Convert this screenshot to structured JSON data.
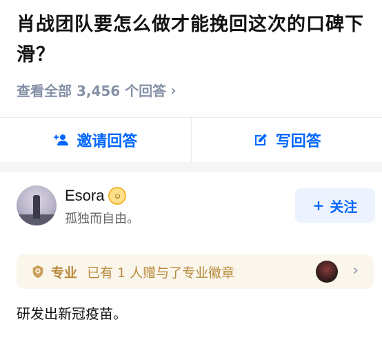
{
  "question": {
    "title": "肖战团队要怎么做才能挽回这次的口碑下滑？",
    "view_all": "查看全部 3,456 个回答",
    "chevron": "›"
  },
  "actions": {
    "invite_label": "邀请回答",
    "write_label": "写回答",
    "invite_icon": "add-person-icon",
    "write_icon": "edit-icon"
  },
  "answer": {
    "author_name": "Esora",
    "author_bio": "孤独而自由。",
    "follow_label": "关注",
    "follow_plus": "+",
    "pro_label": "专业",
    "pro_text": "已有 1 人赠与了专业徽章",
    "pro_chevron": "›",
    "content": "研发出新冠疫苗。"
  },
  "colors": {
    "accent": "#0066ff",
    "muted": "#8590a6",
    "gold": "#b88a3c"
  }
}
